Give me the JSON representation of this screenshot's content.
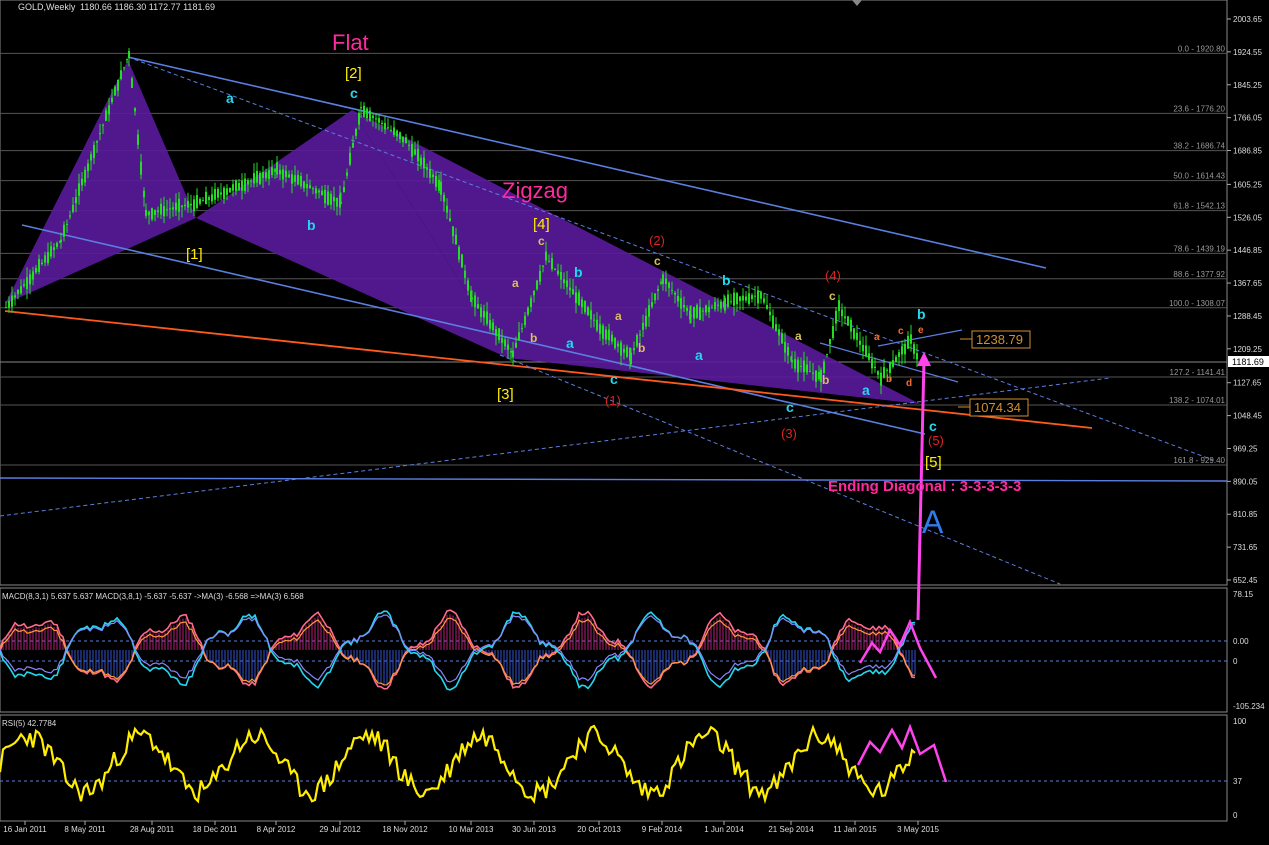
{
  "header": {
    "symbol": "GOLD,Weekly",
    "ohlc": "1180.66 1186.30 1172.77 1181.69"
  },
  "colors": {
    "background": "#000000",
    "candle": "#22dd22",
    "channel_line": "#5b7fe0",
    "wedge_fill": "#5a1a9c",
    "fib_line": "#555555",
    "orange_line": "#ff5a1e",
    "yellow_label": "#ffee00",
    "cyan_label": "#22d8ee",
    "red_label": "#dd2222",
    "pink_label": "#ff2aa0",
    "magenta_arrow": "#ff44ee"
  },
  "chart_data": [
    {
      "type": "line",
      "panel": "price",
      "title": "GOLD,Weekly",
      "ylim": [
        652.45,
        2003.65
      ],
      "y_ticks": [
        "2003.65",
        "1924.55",
        "1845.25",
        "1766.05",
        "1686.85",
        "1605.25",
        "1526.05",
        "1446.85",
        "1367.65",
        "1288.45",
        "1209.25",
        "1181.69",
        "1127.65",
        "1048.45",
        "969.25",
        "890.05",
        "810.85",
        "731.65",
        "652.45"
      ],
      "x_ticks": [
        "16 Jan 2011",
        "8 May 2011",
        "28 Aug 2011",
        "18 Dec 2011",
        "8 Apr 2012",
        "29 Jul 2012",
        "18 Nov 2012",
        "10 Mar 2013",
        "30 Jun 2013",
        "20 Oct 2013",
        "9 Feb 2014",
        "1 Jun 2014",
        "21 Sep 2014",
        "11 Jan 2015",
        "3 May 2015"
      ],
      "series": [
        {
          "name": "",
          "x": [
            "16 Jan 2011",
            "8 May 2011",
            "28 Aug 2011",
            "25 Sep 2011",
            "18 Dec 2011",
            "8 Apr 2012",
            "29 Jul 2012",
            "7 Oct 2012",
            "18 Nov 2012",
            "10 Mar 2013",
            "14 Apr 2013",
            "30 Jun 2013",
            "25 Aug 2013",
            "20 Oct 2013",
            "29 Dec 2013",
            "9 Feb 2014",
            "16 Mar 2014",
            "1 Jun 2014",
            "13 Jul 2014",
            "21 Sep 2014",
            "2 Nov 2014",
            "11 Jan 2015",
            "22 Mar 2015",
            "3 May 2015",
            "21 Jun 2015"
          ],
          "values": [
            1310,
            1470,
            1920,
            1535,
            1560,
            1640,
            1560,
            1790,
            1710,
            1600,
            1330,
            1195,
            1430,
            1260,
            1190,
            1380,
            1290,
            1320,
            1340,
            1180,
            1140,
            1310,
            1140,
            1230,
            1181
          ]
        }
      ],
      "fib_levels": [
        {
          "label": "0.0 - 1920.80",
          "value": 1920.8
        },
        {
          "label": "23.6 - 1776.20",
          "value": 1776.2
        },
        {
          "label": "38.2 - 1686.74",
          "value": 1686.74
        },
        {
          "label": "50.0 - 1614.43",
          "value": 1614.43
        },
        {
          "label": "61.8 - 1542.13",
          "value": 1542.13
        },
        {
          "label": "78.6 - 1439.19",
          "value": 1439.19
        },
        {
          "label": "88.6 - 1377.92",
          "value": 1377.92
        },
        {
          "label": "100.0 - 1308.07",
          "value": 1308.07
        },
        {
          "label": "127.2 - 1141.41",
          "value": 1141.41
        },
        {
          "label": "138.2 - 1074.01",
          "value": 1074.01
        },
        {
          "label": "161.8 - 929.40",
          "value": 929.4
        }
      ],
      "price_boxes": [
        "1238.79",
        "1074.34"
      ],
      "annotations": {
        "pink": [
          "Flat",
          "Zigzag",
          "Ending Diagonal : 3-3-3-3-3"
        ],
        "yellow": [
          "[1]",
          "[2]",
          "[3]",
          "[4]",
          "[5]"
        ],
        "red": [
          "(1)",
          "(2)",
          "(3)",
          "(4)",
          "(5)"
        ],
        "big": "A"
      }
    },
    {
      "type": "line",
      "panel": "macd",
      "title": "MACD(8,3,1) 5.637 5.637 MACD(3,8,1) -5.637 -5.637 ->MA(3) -6.568 =>MA(3) 6.568",
      "ylim": [
        -105.234,
        78.15
      ],
      "y_ticks": [
        "78.15",
        "0.00",
        "0",
        "-105.234"
      ]
    },
    {
      "type": "line",
      "panel": "rsi",
      "title": "RSI(5) 42.7784",
      "ylim": [
        0,
        100
      ],
      "y_ticks": [
        "100",
        "37",
        "0"
      ]
    }
  ]
}
